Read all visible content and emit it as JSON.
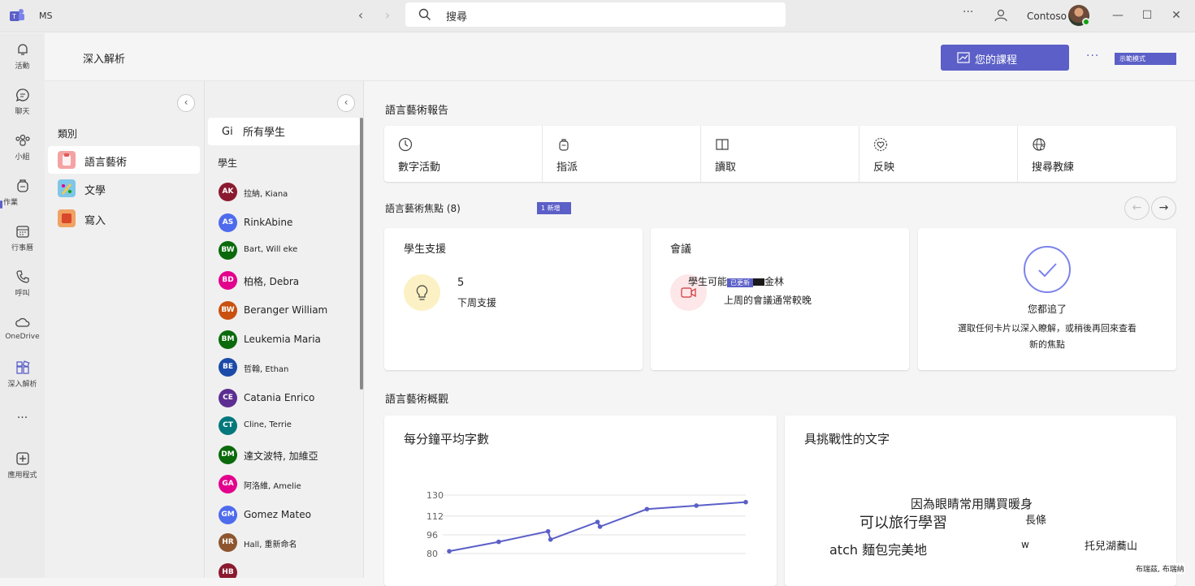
{
  "titlebar": {
    "app_name": "MS",
    "search_text": "搜尋",
    "more": "···",
    "org": "Contoso",
    "minimize": "—",
    "maximize": "☐",
    "close": "✕"
  },
  "rail": [
    {
      "label": "活動",
      "icon": "bell-icon"
    },
    {
      "label": "聊天",
      "icon": "chat-icon"
    },
    {
      "label": "小組",
      "icon": "teams-icon"
    },
    {
      "label": "作業",
      "icon": "assignments-icon"
    },
    {
      "label": "行事曆",
      "icon": "calendar-icon"
    },
    {
      "label": "呼叫",
      "icon": "phone-icon"
    },
    {
      "label": "OneDrive",
      "icon": "cloud-icon"
    },
    {
      "label": "深入解析",
      "icon": "insights-icon"
    },
    {
      "label": "···",
      "icon": "more-icon"
    },
    {
      "label": "應用程式",
      "icon": "add-apps-icon"
    }
  ],
  "header": {
    "title": "深入解析",
    "courses_label": "您的課程",
    "more": "···",
    "demo_label": "示範模式"
  },
  "categories": {
    "heading": "類別",
    "items": [
      {
        "label": "語言藝術",
        "color": "#f4a3a3",
        "active": true
      },
      {
        "label": "文學",
        "color": "#7fc6e8",
        "active": false
      },
      {
        "label": "寫入",
        "color": "#f0a262",
        "active": false
      }
    ]
  },
  "students": {
    "all_prefix": "Gi",
    "all_label": "所有學生",
    "heading": "學生",
    "list": [
      {
        "initials": "AK",
        "name": "拉納, Kiana",
        "color": "#8b1a2f"
      },
      {
        "initials": "AS",
        "name": "RinkAbine",
        "color": "#4f6bed"
      },
      {
        "initials": "BW",
        "name": "Bart, Will eke",
        "color": "#0b6a0b"
      },
      {
        "initials": "BD",
        "name": "柏格, Debra",
        "color": "#e3008c"
      },
      {
        "initials": "BW",
        "name": "Beranger William",
        "color": "#ca5010"
      },
      {
        "initials": "BM",
        "name": "Leukemia Maria",
        "color": "#0b6a0b"
      },
      {
        "initials": "BE",
        "name": "哲翰, Ethan",
        "color": "#1b4aa8"
      },
      {
        "initials": "CE",
        "name": "Catania Enrico",
        "color": "#5c2e91"
      },
      {
        "initials": "CT",
        "name": "Cline, Terrie",
        "color": "#03787c"
      },
      {
        "initials": "DM",
        "name": "達文波特, 加維亞",
        "color": "#0b6a0b"
      },
      {
        "initials": "GA",
        "name": "阿洛維, Amelie",
        "color": "#e3008c"
      },
      {
        "initials": "GM",
        "name": "Gomez Mateo",
        "color": "#4f6bed"
      },
      {
        "initials": "HR",
        "name": "Hall, 重新命名",
        "color": "#8e562e"
      },
      {
        "initials": "HB",
        "name": "",
        "color": "#8b1a2f"
      }
    ]
  },
  "report": {
    "title": "語言藝術報告",
    "items": [
      {
        "label": "數字活動",
        "icon": "clock-icon"
      },
      {
        "label": "指派",
        "icon": "backpack-icon"
      },
      {
        "label": "讀取",
        "icon": "book-icon"
      },
      {
        "label": "反映",
        "icon": "heart-icon"
      },
      {
        "label": "搜尋教練",
        "icon": "globe-icon"
      }
    ]
  },
  "spotlight": {
    "title": "語言藝術焦點 (8)",
    "new_badge": "1 新增",
    "prev": "←",
    "next": "→",
    "support": {
      "title": "學生支援",
      "count": "5",
      "sub": "下周支援"
    },
    "meeting": {
      "title": "會議",
      "line1_prefix": "學生可能",
      "line1_badge": "已更新",
      "line1_suffix": "金林",
      "line2": "上周的會議通常較晚"
    },
    "caught_up": {
      "title": "您都追了",
      "line1": "選取任何卡片以深入瞭解，或稍後再回來查看",
      "line2": "新的焦點"
    }
  },
  "overview": {
    "title": "語言藝術概觀",
    "wpm_title": "每分鐘平均字數",
    "words_title": "具挑戰性的文字",
    "words": [
      {
        "text": "因為眼睛常用購買暖身"
      },
      {
        "text": "可以旅行學習"
      },
      {
        "text": "長條"
      },
      {
        "text": "atch 麵包完美地"
      },
      {
        "text": "w"
      },
      {
        "text": "托兒湖蕎山"
      }
    ],
    "footer_name": "布瑞茲, 布瑞納"
  },
  "colors": {
    "accent": "#5b5fc7",
    "line": "#5b5fc7"
  },
  "chart_data": {
    "type": "line",
    "title": "每分鐘平均字數",
    "yticks": [
      "130",
      "112",
      "96",
      "80"
    ],
    "ylim": [
      80,
      130
    ],
    "series": [
      {
        "values": [
          82,
          90,
          99,
          92,
          107,
          103,
          118,
          121,
          124
        ]
      }
    ],
    "x": [
      1,
      2,
      3,
      3.05,
      4,
      4.05,
      5,
      6,
      7
    ]
  }
}
